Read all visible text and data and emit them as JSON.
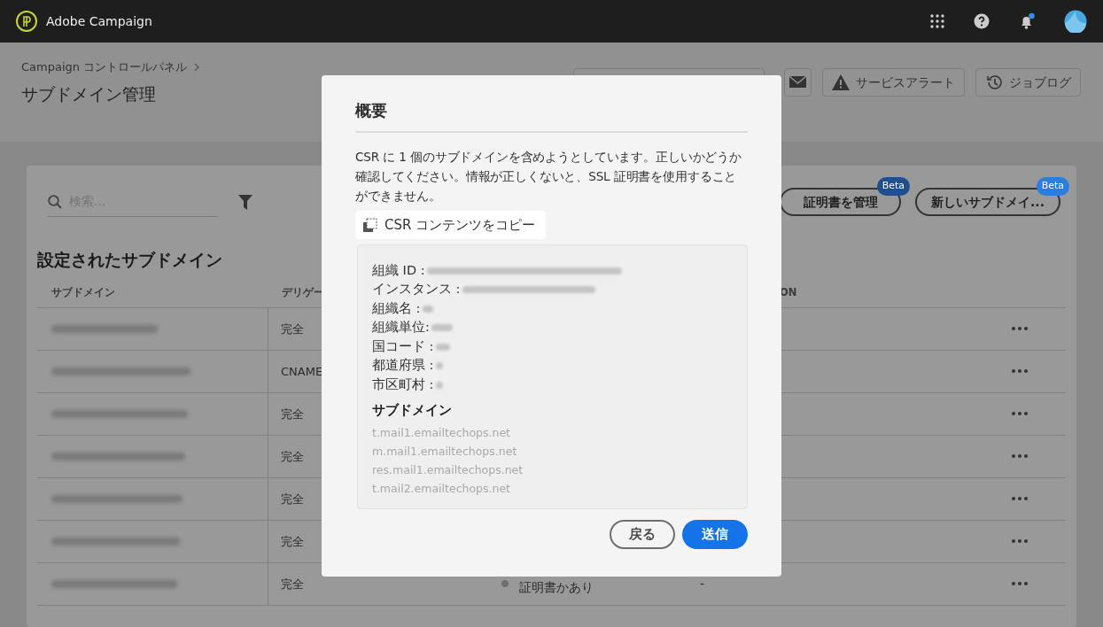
{
  "app": {
    "title": "Adobe Campaign"
  },
  "breadcrumb": "Campaign コントロールパネル",
  "page_title": "サブドメイン管理",
  "header_buttons": [
    {
      "kind": "mail"
    },
    {
      "kind": "alert",
      "label": "サービスアラート"
    },
    {
      "kind": "history",
      "label": "ジョブログ"
    }
  ],
  "search": {
    "placeholder": "検索..."
  },
  "actions": [
    {
      "label": "証明書を管理",
      "badge": "Beta",
      "color": "#1f4f8f"
    },
    {
      "label": "新しいサブドメイ...",
      "badge": "Beta",
      "color": "#2b7de0"
    }
  ],
  "section_title": "設定されたサブドメイン",
  "table": {
    "columns": [
      "サブドメイン",
      "デリゲー",
      "",
      "ON"
    ],
    "rows": [
      {
        "delegation": "完全"
      },
      {
        "delegation": "CNAME"
      },
      {
        "delegation": "完全"
      },
      {
        "delegation": "完全"
      },
      {
        "delegation": "完全"
      },
      {
        "delegation": "完全"
      },
      {
        "delegation": "完全",
        "status": "証明書かあり",
        "column_4": "-"
      }
    ]
  },
  "modal": {
    "title": "概要",
    "message": "CSR に 1 個のサブドメインを含めようとしています。正しいかどうか確認してください。情報が正しくないと、SSL 証明書を使用することができません。",
    "copy_button": "CSR コンテンツをコピー",
    "fields": [
      {
        "label": "組織 ID :"
      },
      {
        "label": "インスタンス :"
      },
      {
        "label": "組織名 :"
      },
      {
        "label": "組織単位:"
      },
      {
        "label": "国コード :"
      },
      {
        "label": "都道府県 :"
      },
      {
        "label": "市区町村 :"
      }
    ],
    "subdomains_title": "サブドメイン",
    "subdomains": [
      "t.mail1.emailtechops.net",
      "m.mail1.emailtechops.net",
      "res.mail1.emailtechops.net",
      "t.mail2.emailtechops.net"
    ],
    "buttons": [
      {
        "kind": "secondary",
        "label": "戻る"
      },
      {
        "kind": "primary",
        "label": "送信"
      }
    ]
  }
}
